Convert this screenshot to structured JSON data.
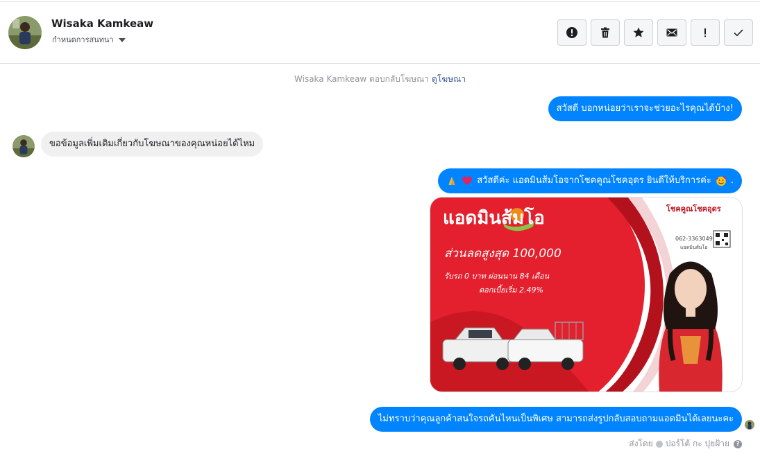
{
  "header": {
    "contact_name": "Wisaka Kamkeaw",
    "assign_label": "กำหนดการสนทนา"
  },
  "toolbar": {
    "icons": [
      "spam-icon",
      "trash-icon",
      "star-icon",
      "envelope-icon",
      "exclamation-icon",
      "check-icon"
    ]
  },
  "conversation": {
    "ad_notice": {
      "text": "Wisaka Kamkeaw ตอบกลับโฆษณา",
      "link": "ดูโฆษณา"
    },
    "messages": [
      {
        "direction": "outgoing",
        "text": "สวัสดี บอกหน่อยว่าเราจะช่วยอะไรคุณได้บ้าง!"
      },
      {
        "direction": "incoming",
        "text": "ขอข้อมูลเพิ่มเติมเกี่ยวกับโฆษณาของคุณหน่อยได้ไหม"
      },
      {
        "direction": "outgoing",
        "text": "สวัสดีค่ะ แอดมินส้มโอจากโชคคูณโชคอุดร ยินดีให้บริการค่ะ",
        "suffix": "."
      },
      {
        "direction": "outgoing",
        "text": "ไม่ทราบว่าคุณลูกค้าสนใจรถคันไหนเป็นพิเศษ สามารถส่งรูปกลับสอบถามแอดมินได้เลยนะคะ"
      }
    ],
    "ad_image": {
      "brand_title": "แอดมินส้มโอ",
      "discount_line": "ส่วนลดสูงสุด 100,000",
      "terms_line": "รับรถ 0 บาท ผ่อนนาน 84 เดือน",
      "interest_line": "ดอกเบี้ยเริ่ม 2.49%",
      "dealer_name": "โชคคูณโชคอุดร",
      "phone": "062-3363049",
      "contact_label": "แอดมินส้มโอ"
    },
    "sent_by": {
      "prefix": "ส่งโดย",
      "name": "ปอร์โต้ กะ ปุยฝ้าย"
    }
  },
  "colors": {
    "outgoing_bubble": "#0084ff",
    "incoming_bubble": "#f1f0f0",
    "ad_red": "#e4202e",
    "link": "#365899"
  }
}
